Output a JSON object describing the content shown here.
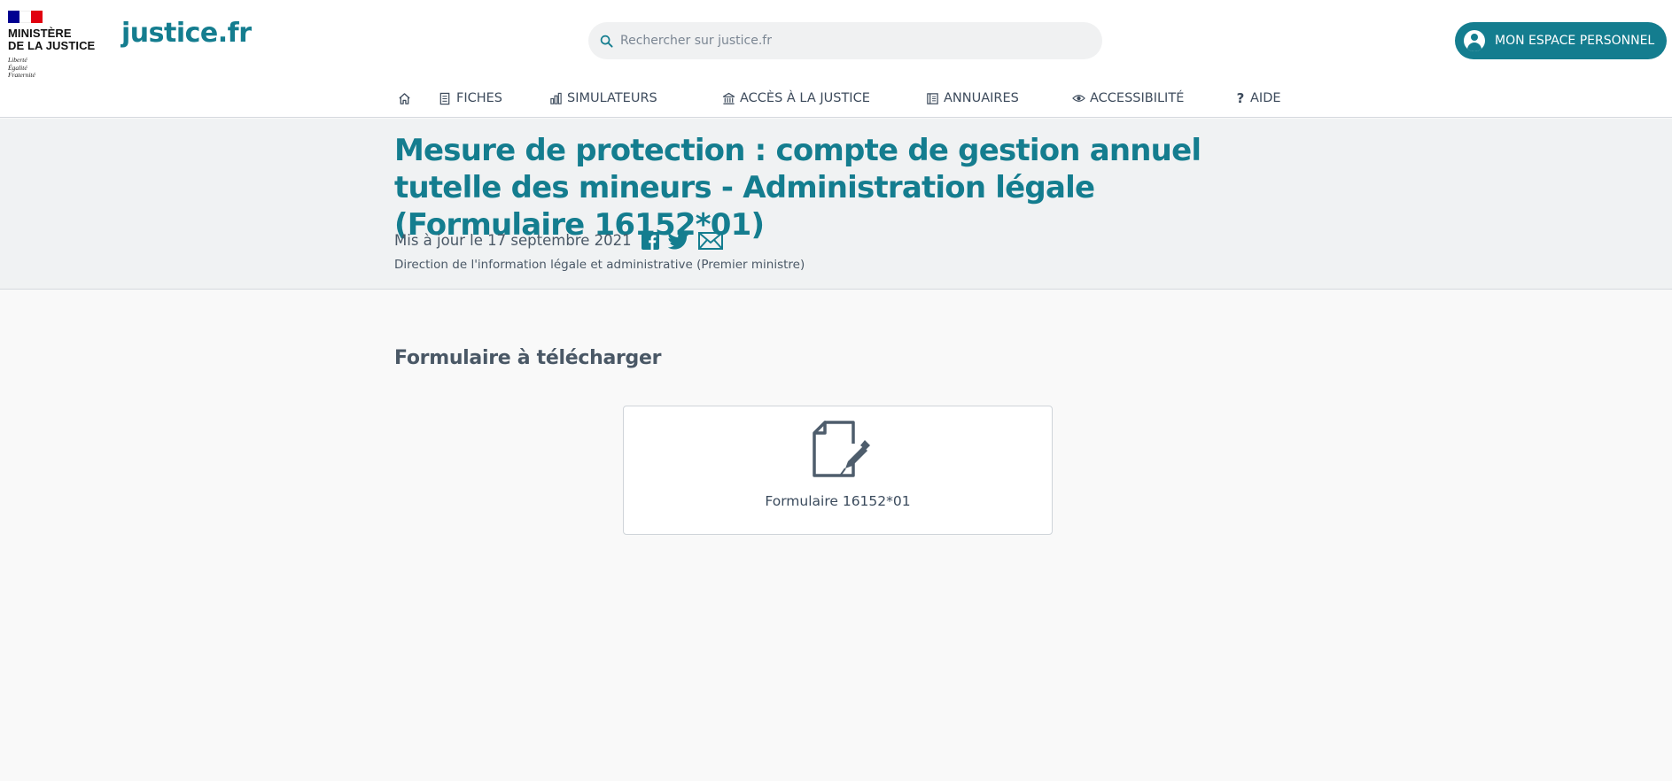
{
  "logo": {
    "ministry_line1": "MINISTÈRE",
    "ministry_line2": "DE LA JUSTICE",
    "motto": [
      "Liberté",
      "Égalité",
      "Fraternité"
    ],
    "flag_colors": [
      "#000091",
      "#ffffff",
      "#e1000f"
    ]
  },
  "brand": "justice.fr",
  "search": {
    "placeholder": "Rechercher sur justice.fr",
    "icon": "search-icon"
  },
  "account": {
    "label": "MON ESPACE PERSONNEL",
    "icon": "user-icon"
  },
  "nav": {
    "home_icon": "home-icon",
    "items": [
      {
        "label": "FICHES",
        "icon": "document-icon"
      },
      {
        "label": "SIMULATEURS",
        "icon": "bar-chart-icon"
      },
      {
        "label": "ACCÈS À LA JUSTICE",
        "icon": "courthouse-icon"
      },
      {
        "label": "ANNUAIRES",
        "icon": "book-icon"
      },
      {
        "label": "ACCESSIBILITÉ",
        "icon": "eye-icon"
      },
      {
        "label": "AIDE",
        "icon": "question-icon"
      }
    ]
  },
  "page": {
    "title": "Mesure de protection : compte de gestion annuel tutelle des mineurs - Administration légale (Formulaire 16152*01)",
    "updated": "Mis à jour le 17 septembre 2021",
    "author": "Direction de l'information légale et administrative (Premier ministre)",
    "share_icons": [
      "facebook-icon",
      "twitter-icon",
      "mail-icon"
    ]
  },
  "download": {
    "section_title": "Formulaire à télécharger",
    "form_label": "Formulaire 16152*01",
    "icon": "document-sign-icon"
  },
  "colors": {
    "brand": "#147d8f",
    "text": "#3a4a5c",
    "band": "#f0f2f3",
    "page": "#f9f9f9"
  }
}
